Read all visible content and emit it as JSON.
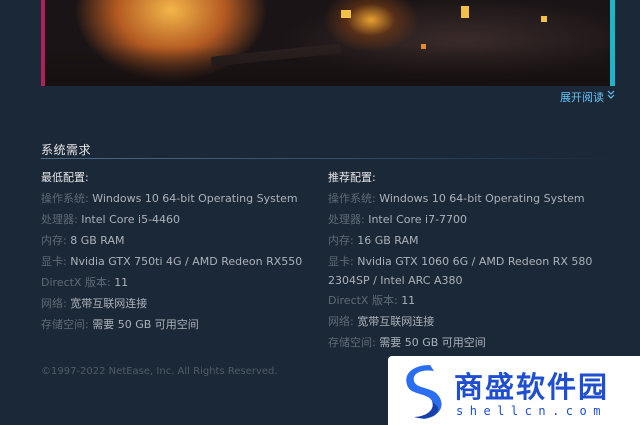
{
  "expand_link": {
    "label": "展开阅读",
    "icon": "chevron-down-double-icon"
  },
  "system_requirements": {
    "title": "系统需求",
    "minimum": {
      "heading": "最低配置:",
      "rows": [
        {
          "label": "操作系统:",
          "value": "Windows 10 64-bit Operating System"
        },
        {
          "label": "处理器:",
          "value": "Intel Core i5-4460"
        },
        {
          "label": "内存:",
          "value": "8 GB RAM"
        },
        {
          "label": "显卡:",
          "value": "Nvidia GTX 750ti 4G / AMD Redeon RX550"
        },
        {
          "label": "DirectX 版本:",
          "value": "11"
        },
        {
          "label": "网络:",
          "value": "宽带互联网连接"
        },
        {
          "label": "存储空间:",
          "value": "需要 50 GB 可用空间"
        }
      ]
    },
    "recommended": {
      "heading": "推荐配置:",
      "rows": [
        {
          "label": "操作系统:",
          "value": "Windows 10 64-bit Operating System"
        },
        {
          "label": "处理器:",
          "value": "Intel Core i7-7700"
        },
        {
          "label": "内存:",
          "value": "16 GB RAM"
        },
        {
          "label": "显卡:",
          "value": "Nvidia GTX 1060 6G / AMD Redeon RX 580 2304SP / Intel ARC A380"
        },
        {
          "label": "DirectX 版本:",
          "value": "11"
        },
        {
          "label": "网络:",
          "value": "宽带互联网连接"
        },
        {
          "label": "存储空间:",
          "value": "需要 50 GB 可用空间"
        }
      ]
    }
  },
  "footer": {
    "copyright": "©1997-2022 NetEase, Inc. All Rights Reserved."
  },
  "watermark": {
    "text": "商盛软件园",
    "subtext": "shellcn.com"
  },
  "colors": {
    "background": "#1b2838",
    "link": "#67c1f5",
    "label": "#5f6a74",
    "value": "#acb2b8",
    "watermark_blue": "#1f4fd0"
  }
}
